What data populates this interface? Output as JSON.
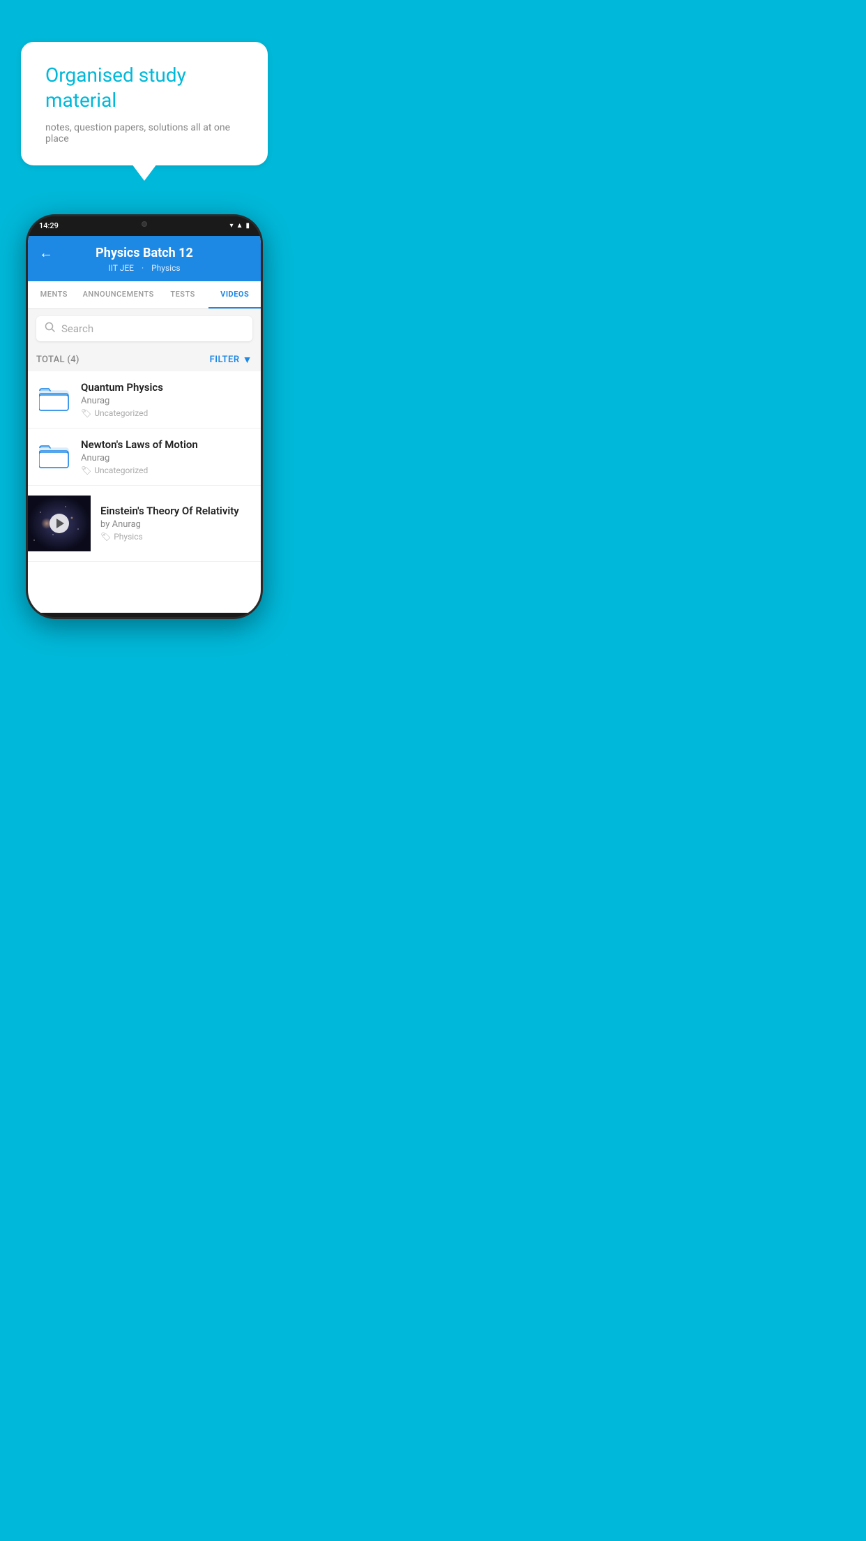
{
  "background_color": "#00b8d9",
  "bubble": {
    "title": "Organised study material",
    "subtitle": "notes, question papers, solutions all at one place"
  },
  "phone": {
    "status_bar": {
      "time": "14:29",
      "icons": [
        "wifi",
        "signal",
        "battery"
      ]
    },
    "header": {
      "title": "Physics Batch 12",
      "subtitle_part1": "IIT JEE",
      "subtitle_part2": "Physics",
      "back_label": "←"
    },
    "tabs": [
      {
        "label": "MENTS",
        "active": false
      },
      {
        "label": "ANNOUNCEMENTS",
        "active": false
      },
      {
        "label": "TESTS",
        "active": false
      },
      {
        "label": "VIDEOS",
        "active": true
      }
    ],
    "search": {
      "placeholder": "Search"
    },
    "filter": {
      "total_label": "TOTAL (4)",
      "filter_label": "FILTER"
    },
    "videos": [
      {
        "id": 1,
        "title": "Quantum Physics",
        "author": "Anurag",
        "tag": "Uncategorized",
        "has_thumbnail": false
      },
      {
        "id": 2,
        "title": "Newton's Laws of Motion",
        "author": "Anurag",
        "tag": "Uncategorized",
        "has_thumbnail": false
      },
      {
        "id": 3,
        "title": "Einstein's Theory Of Relativity",
        "author": "by Anurag",
        "tag": "Physics",
        "has_thumbnail": true
      }
    ]
  }
}
